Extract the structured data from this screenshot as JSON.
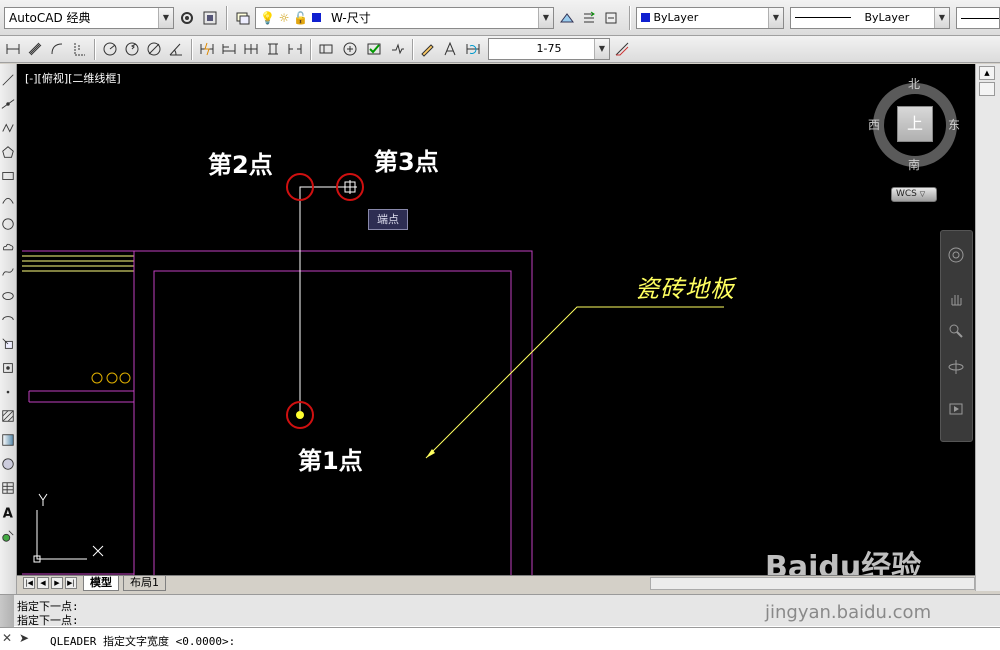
{
  "toolbar_top": {
    "workspace": "AutoCAD 经典",
    "layer": "W-尺寸",
    "color": "ByLayer",
    "linetype": "ByLayer",
    "dim_scale": "1-75"
  },
  "viewport": {
    "label": "[-][俯视][二维线框]"
  },
  "viewcube": {
    "north": "北",
    "south": "南",
    "east": "东",
    "west": "西",
    "face": "上",
    "wcs": "WCS"
  },
  "annotations": {
    "point1": "第1点",
    "point2": "第2点",
    "point3": "第3点",
    "snap_tooltip": "端点",
    "leader_text": "瓷砖地板"
  },
  "ucs": {
    "x": "X",
    "y": "Y"
  },
  "tabs": [
    {
      "label": "模型"
    },
    {
      "label": "布局1"
    }
  ],
  "command": {
    "history": [
      "指定下一点:",
      "指定下一点:"
    ],
    "current": "QLEADER 指定文字宽度 <0.0000>:"
  },
  "watermark": {
    "brand": "Baidu经验",
    "url": "jingyan.baidu.com"
  },
  "colors": {
    "background": "#000000",
    "magenta_lines": "#c040c0",
    "leader_yellow": "#ffff60",
    "marker_red": "#d01010"
  }
}
